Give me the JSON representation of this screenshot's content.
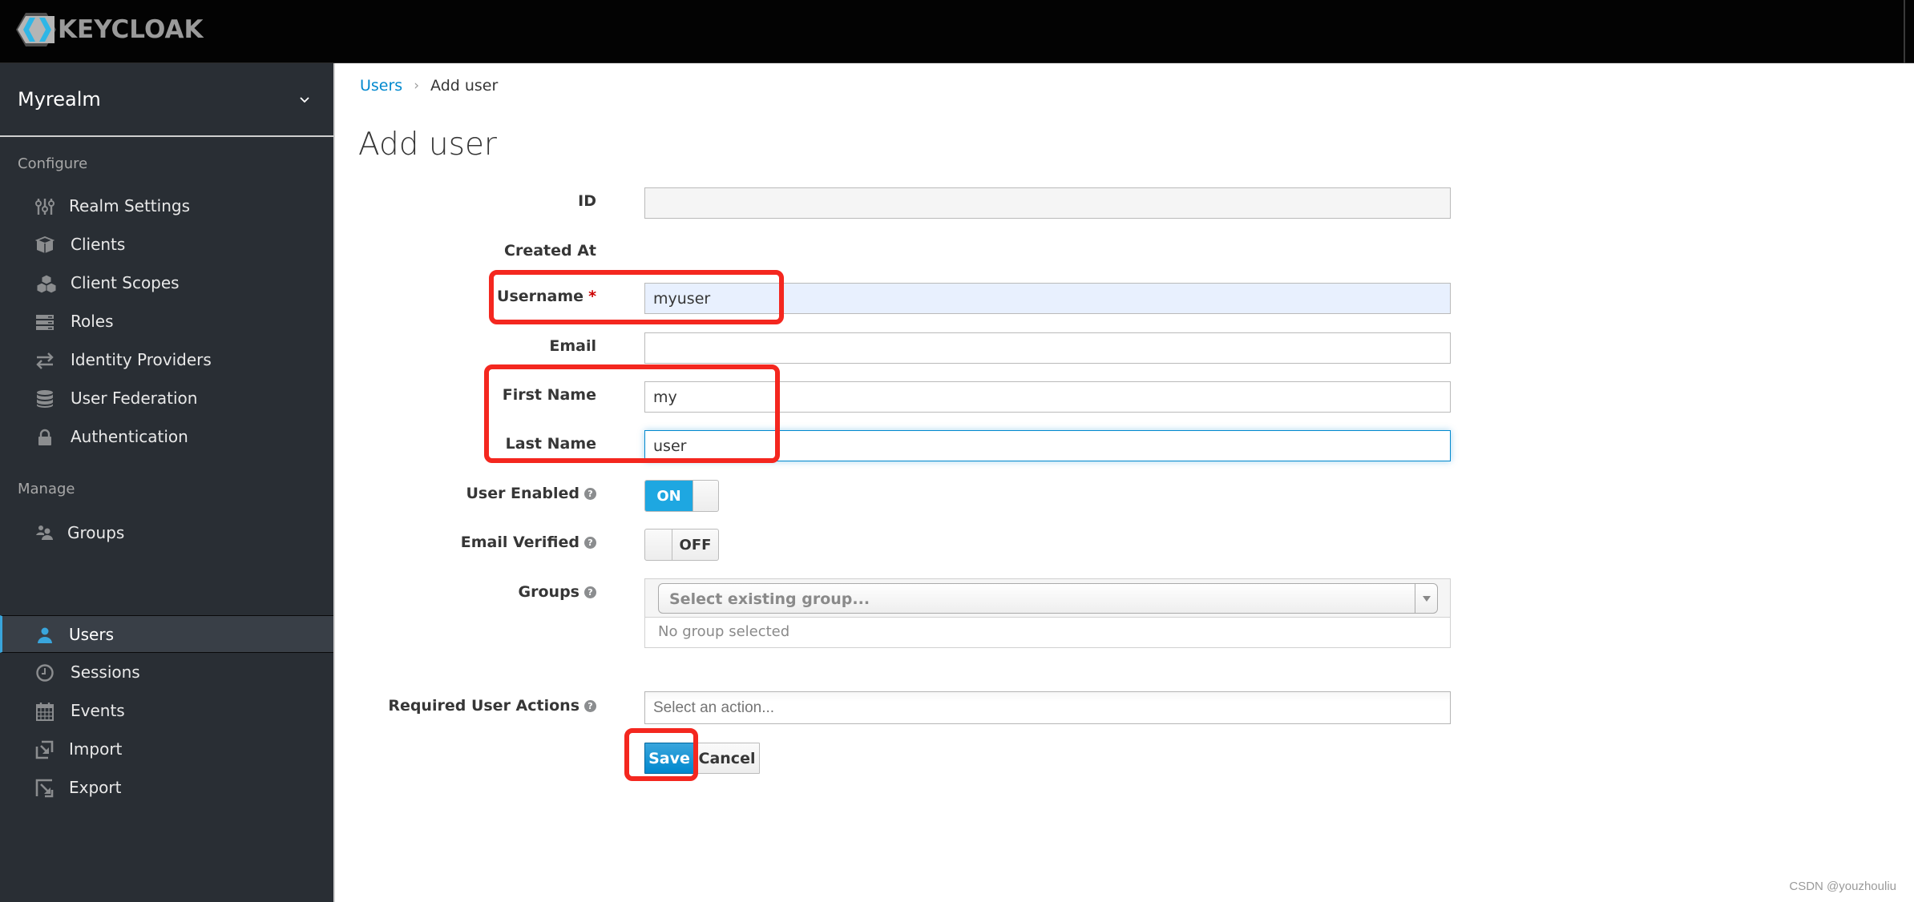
{
  "header": {
    "logo_text": "KEYCLOAK",
    "logo_icon": "keycloak-hexagon-logo"
  },
  "sidebar": {
    "realm": {
      "name": "Myrealm",
      "icon": "chevron-down-icon"
    },
    "sections": [
      {
        "title": "Configure",
        "items": [
          {
            "label": "Realm Settings",
            "icon": "sliders-icon"
          },
          {
            "label": "Clients",
            "icon": "cube-icon"
          },
          {
            "label": "Client Scopes",
            "icon": "cubes-icon"
          },
          {
            "label": "Roles",
            "icon": "server-stack-icon"
          },
          {
            "label": "Identity Providers",
            "icon": "exchange-icon"
          },
          {
            "label": "User Federation",
            "icon": "database-icon"
          },
          {
            "label": "Authentication",
            "icon": "lock-icon"
          }
        ]
      },
      {
        "title": "Manage",
        "items": [
          {
            "label": "Groups",
            "icon": "users-icon"
          },
          {
            "label": "Users",
            "icon": "user-icon",
            "active": true
          },
          {
            "label": "Sessions",
            "icon": "clock-icon"
          },
          {
            "label": "Events",
            "icon": "calendar-icon"
          },
          {
            "label": "Import",
            "icon": "import-icon"
          },
          {
            "label": "Export",
            "icon": "export-icon"
          }
        ]
      }
    ]
  },
  "breadcrumb": {
    "link": "Users",
    "separator": "›",
    "current": "Add user"
  },
  "page": {
    "title": "Add user",
    "form": {
      "id": {
        "label": "ID",
        "value": ""
      },
      "created_at": {
        "label": "Created At",
        "value": ""
      },
      "username": {
        "label": "Username",
        "required_mark": "*",
        "value": "myuser"
      },
      "email": {
        "label": "Email",
        "value": ""
      },
      "first_name": {
        "label": "First Name",
        "value": "my"
      },
      "last_name": {
        "label": "Last Name",
        "value": "user"
      },
      "user_enabled": {
        "label": "User Enabled",
        "state": "ON",
        "help": "?"
      },
      "email_verified": {
        "label": "Email Verified",
        "state": "OFF",
        "help": "?"
      },
      "groups": {
        "label": "Groups",
        "help": "?",
        "placeholder": "Select existing group...",
        "empty_text": "No group selected"
      },
      "required_actions": {
        "label": "Required User Actions",
        "help": "?",
        "placeholder": "Select an action..."
      }
    },
    "buttons": {
      "save": "Save",
      "cancel": "Cancel"
    }
  },
  "colors": {
    "header_bg": "#030303",
    "sidebar_bg": "#292e34",
    "sidebar_active_bg": "#393f47",
    "accent": "#0088ce",
    "toggle_on": "#1ea7e1",
    "annotation": "#f4271f"
  },
  "watermark": "CSDN @youzhouliu"
}
